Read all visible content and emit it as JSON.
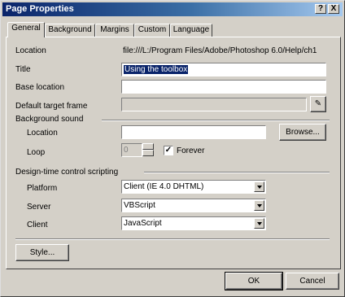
{
  "window": {
    "title": "Page Properties",
    "help_button": "?",
    "close_button": "X"
  },
  "tabs": [
    {
      "label": "General"
    },
    {
      "label": "Background"
    },
    {
      "label": "Margins"
    },
    {
      "label": "Custom"
    },
    {
      "label": "Language"
    }
  ],
  "general": {
    "location_label": "Location",
    "location_value": "file:///L:/Program Files/Adobe/Photoshop 6.0/Help/ch1",
    "title_label": "Title",
    "title_value": "Using the toolbox",
    "base_location_label": "Base location",
    "base_location_value": "",
    "default_target_label": "Default target frame",
    "default_target_value": "",
    "edit_button": "✎"
  },
  "background_sound": {
    "group_label": "Background sound",
    "location_label": "Location",
    "location_value": "",
    "browse_label": "Browse...",
    "loop_label": "Loop",
    "loop_value": "0",
    "forever_label": "Forever",
    "forever_checked": "✓"
  },
  "design_time": {
    "group_label": "Design-time control scripting",
    "platform_label": "Platform",
    "platform_value": "Client (IE 4.0 DHTML)",
    "server_label": "Server",
    "server_value": "VBScript",
    "client_label": "Client",
    "client_value": "JavaScript"
  },
  "style_button": "Style...",
  "footer": {
    "ok_label": "OK",
    "cancel_label": "Cancel"
  }
}
